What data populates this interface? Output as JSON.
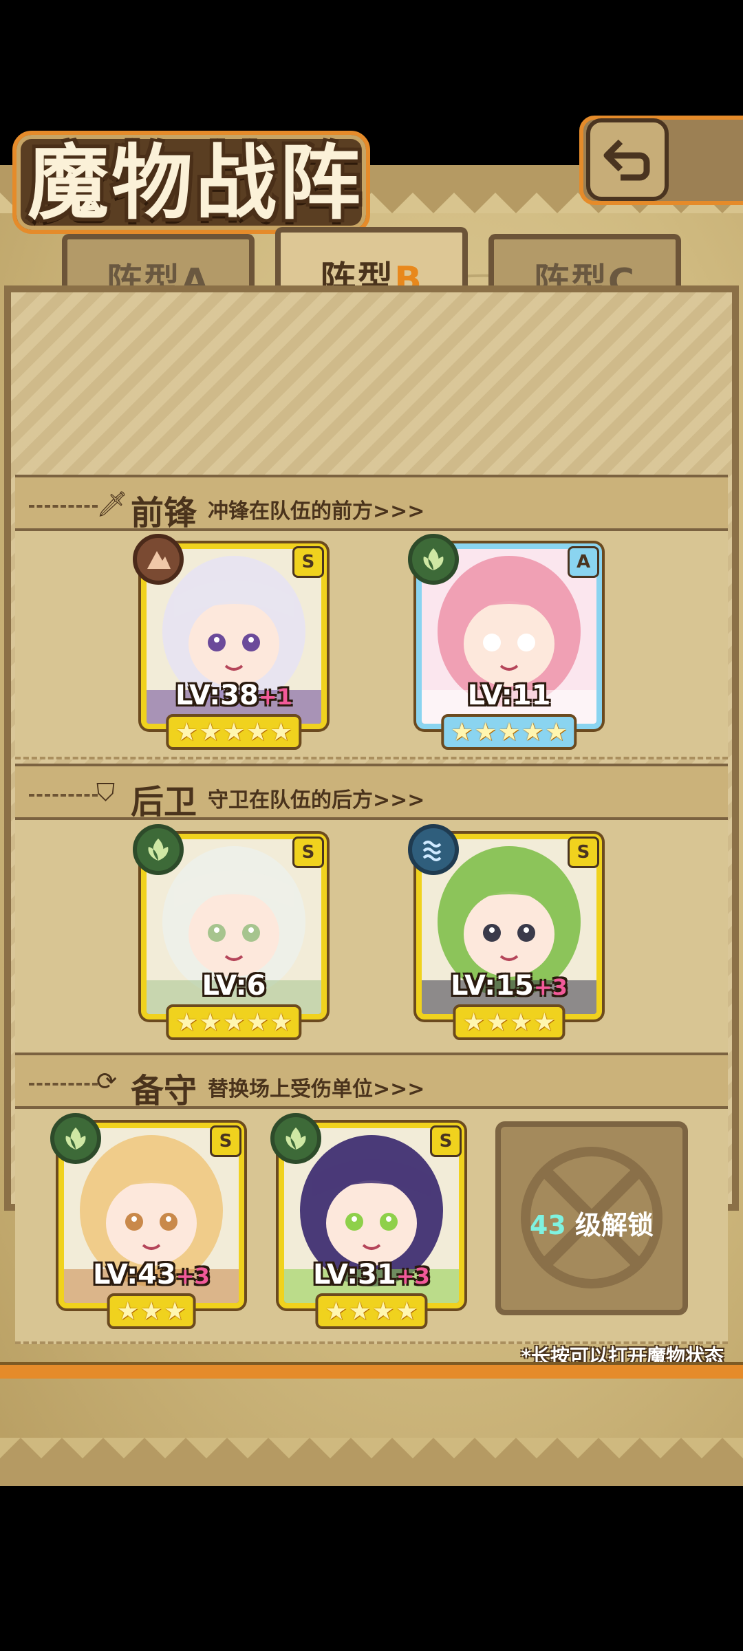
{
  "title": "魔物战阵",
  "back_icon": "return-arrow-icon",
  "tabs": [
    {
      "label": "阵型",
      "letter": "A",
      "active": false
    },
    {
      "label": "阵型",
      "letter": "B",
      "active": true
    },
    {
      "label": "阵型",
      "letter": "C",
      "active": false
    }
  ],
  "sections": [
    {
      "icon": "sword-icon",
      "title": "前锋",
      "desc": "冲锋在队伍的前方>>>"
    },
    {
      "icon": "shield-icon",
      "title": "后卫",
      "desc": "守卫在队伍的后方>>>"
    },
    {
      "icon": "swap-icon",
      "title": "备守",
      "desc": "替换场上受伤单位>>>"
    }
  ],
  "front": [
    {
      "element": "rock",
      "rank": "S",
      "level": "LV:38",
      "plus": "+1",
      "stars": 5,
      "hair": "#e8e4f0",
      "accent": "#6b4a9a"
    },
    {
      "element": "leaf",
      "rank": "A",
      "level": "LV:11",
      "plus": "",
      "stars": 5,
      "hair": "#f0a0b4",
      "accent": "#ffffff"
    }
  ],
  "back": [
    {
      "element": "leaf",
      "rank": "S",
      "level": "LV:6",
      "plus": "",
      "stars": 5,
      "hair": "#eef0e8",
      "accent": "#a6c48e"
    },
    {
      "element": "water",
      "rank": "S",
      "level": "LV:15",
      "plus": "+3",
      "stars": 4,
      "hair": "#8cc45a",
      "accent": "#3a3a4a"
    }
  ],
  "reserve": [
    {
      "element": "leaf",
      "rank": "S",
      "level": "LV:43",
      "plus": "+3",
      "stars": 3,
      "hair": "#f0cc8a",
      "accent": "#c9894a"
    },
    {
      "element": "leaf",
      "rank": "S",
      "level": "LV:31",
      "plus": "+3",
      "stars": 4,
      "hair": "#4a3a78",
      "accent": "#8ed04a"
    }
  ],
  "locked_slot": {
    "level": "43",
    "text": "级解锁"
  },
  "footnote": "*长按可以打开魔物状态",
  "colors": {
    "accent_orange": "#e58b2a",
    "card_gold": "#f0d21e",
    "card_blue": "#8ad4f0",
    "text_brown": "#4a331c"
  }
}
